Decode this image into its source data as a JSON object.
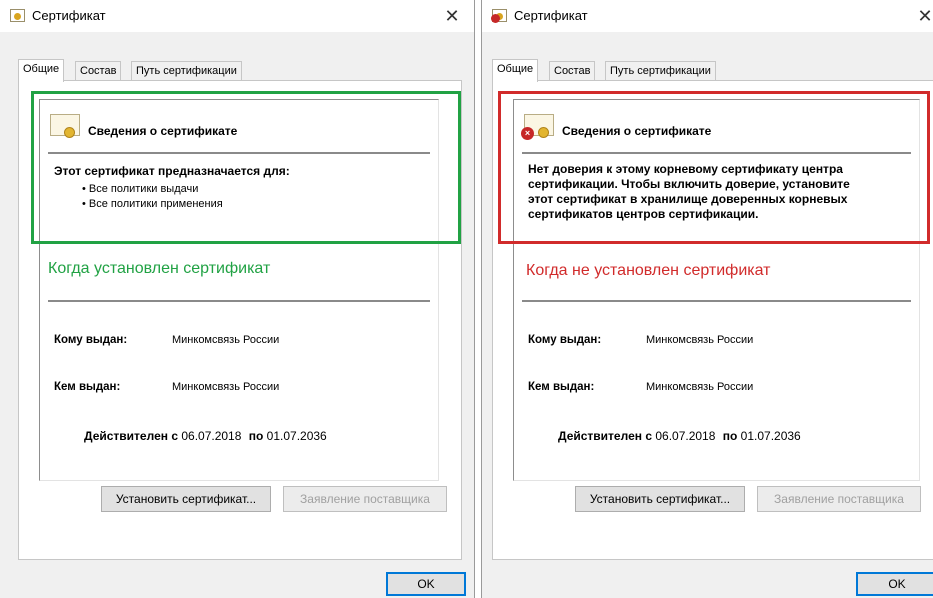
{
  "colors": {
    "installed_accent": "#21a244",
    "not_installed_accent": "#d12b2b",
    "ok_border": "#0078d7"
  },
  "left": {
    "title": "Сертификат",
    "close": "✕",
    "tabs": [
      "Общие",
      "Состав",
      "Путь сертификации"
    ],
    "info_title": "Сведения о сертификате",
    "purpose_heading": "Этот сертификат предназначается для:",
    "purposes": [
      "Все политики выдачи",
      "Все политики применения"
    ],
    "caption": "Когда установлен сертификат",
    "issued_to_label": "Кому выдан:",
    "issued_to_value": "Минкомсвязь России",
    "issued_by_label": "Кем выдан:",
    "issued_by_value": "Минкомсвязь России",
    "valid_from_label": "Действителен с",
    "valid_from": "06.07.2018",
    "valid_to_label": "по",
    "valid_to": "01.07.2036",
    "install_button": "Установить сертификат...",
    "issuer_statement_button": "Заявление поставщика",
    "ok_button": "OK"
  },
  "right": {
    "title": "Сертификат",
    "close": "✕",
    "tabs": [
      "Общие",
      "Состав",
      "Путь сертификации"
    ],
    "info_title": "Сведения о сертификате",
    "warning": "Нет доверия к этому корневому сертификату центра сертификации. Чтобы включить доверие, установите этот сертификат в хранилище доверенных корневых сертификатов центров сертификации.",
    "caption": "Когда не установлен сертификат",
    "issued_to_label": "Кому выдан:",
    "issued_to_value": "Минкомсвязь России",
    "issued_by_label": "Кем выдан:",
    "issued_by_value": "Минкомсвязь России",
    "valid_from_label": "Действителен с",
    "valid_from": "06.07.2018",
    "valid_to_label": "по",
    "valid_to": "01.07.2036",
    "install_button": "Установить сертификат...",
    "issuer_statement_button": "Заявление поставщика",
    "ok_button": "OK"
  }
}
